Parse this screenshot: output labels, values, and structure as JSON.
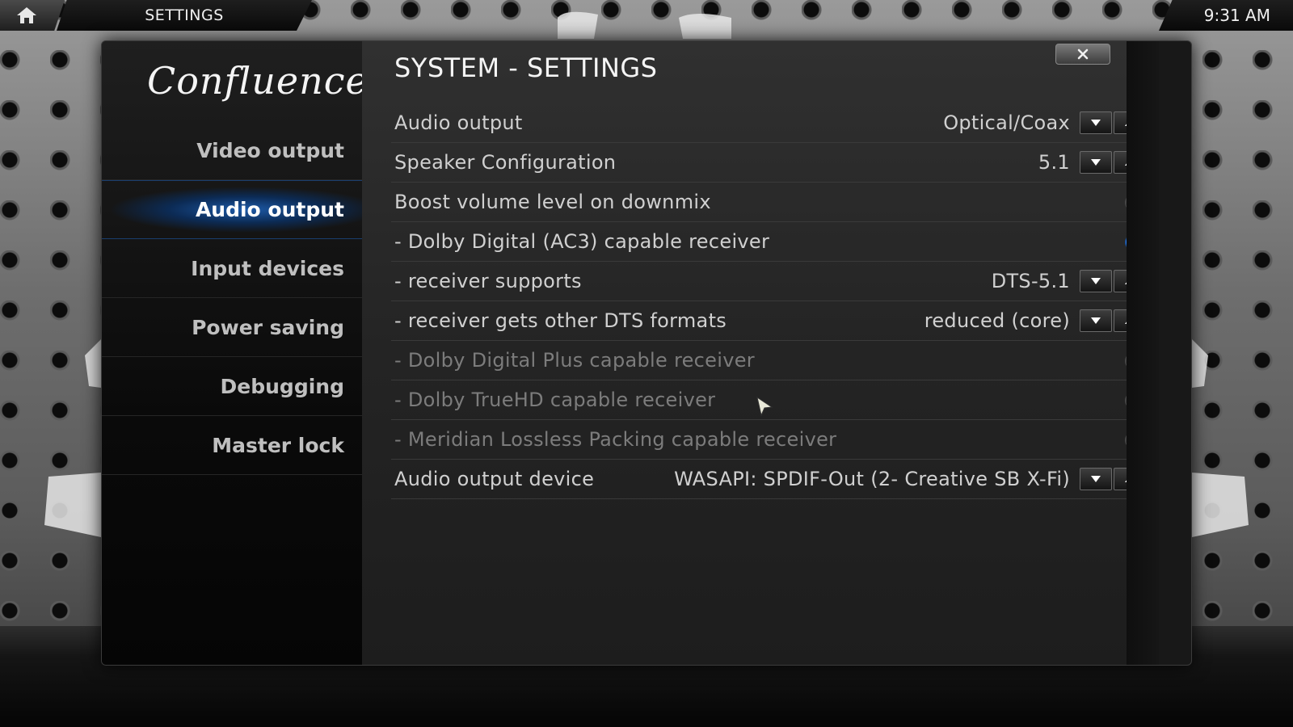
{
  "topbar": {
    "home_icon": "home-icon",
    "title": "SETTINGS",
    "clock": "9:31 AM"
  },
  "sidebar": {
    "logo": "Confluence",
    "items": [
      {
        "label": "Video output"
      },
      {
        "label": "Audio output",
        "active": true
      },
      {
        "label": "Input devices"
      },
      {
        "label": "Power saving"
      },
      {
        "label": "Debugging"
      },
      {
        "label": "Master lock"
      }
    ]
  },
  "content": {
    "title": "SYSTEM - SETTINGS",
    "close_icon": "close-icon",
    "rows": [
      {
        "label": "Audio output",
        "value": "Optical/Coax",
        "control": "spinner"
      },
      {
        "label": "Speaker Configuration",
        "value": "5.1",
        "control": "spinner"
      },
      {
        "label": "Boost volume level on downmix",
        "control": "radio",
        "checked": false
      },
      {
        "label": "- Dolby Digital (AC3) capable receiver",
        "control": "radio",
        "checked": true
      },
      {
        "label": "- receiver supports",
        "value": "DTS-5.1",
        "control": "spinner"
      },
      {
        "label": "- receiver gets other DTS formats",
        "value": "reduced (core)",
        "control": "spinner"
      },
      {
        "label": "- Dolby Digital Plus capable receiver",
        "control": "radio",
        "checked": false,
        "disabled": true
      },
      {
        "label": "- Dolby TrueHD capable receiver",
        "control": "radio",
        "checked": false,
        "disabled": true
      },
      {
        "label": "- Meridian Lossless Packing capable receiver",
        "control": "radio",
        "checked": false,
        "disabled": true
      },
      {
        "label": "Audio output device",
        "value": "WASAPI: SPDIF-Out (2- Creative SB X-Fi)",
        "control": "spinner"
      }
    ]
  },
  "colors": {
    "accent": "#1c6ad8",
    "text": "#d0d0d0",
    "disabled_text": "#7c7c7c"
  }
}
